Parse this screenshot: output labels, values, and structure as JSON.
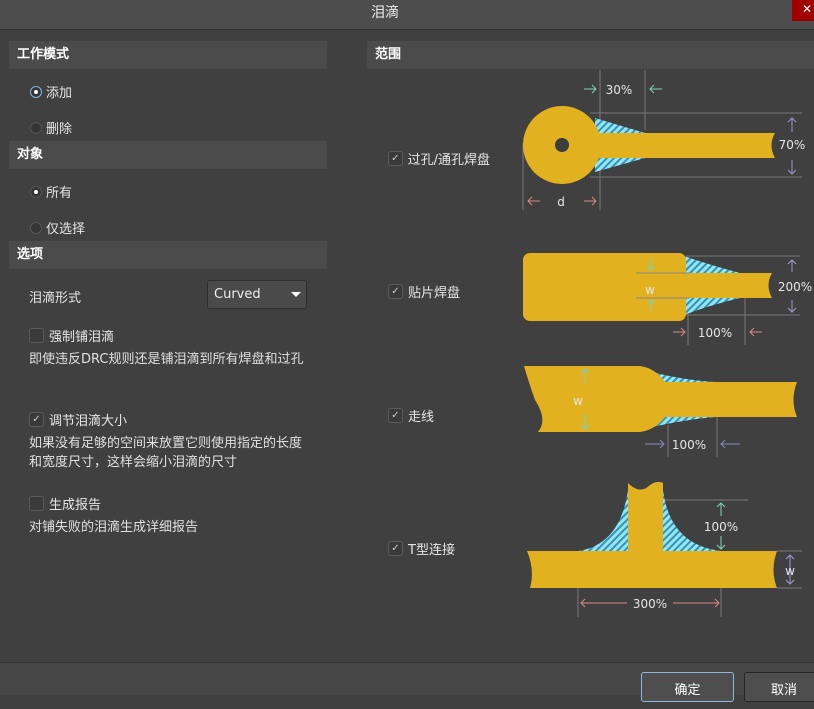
{
  "window": {
    "title": "泪滴",
    "close_icon": "close-icon"
  },
  "mode": {
    "header": "工作模式",
    "options": [
      {
        "label": "添加",
        "selected": true
      },
      {
        "label": "删除",
        "selected": false
      }
    ]
  },
  "target": {
    "header": "对象",
    "options": [
      {
        "label": "所有",
        "selected": true
      },
      {
        "label": "仅选择",
        "selected": false
      }
    ]
  },
  "options": {
    "header": "选项",
    "style_label": "泪滴形式",
    "style_value": "Curved",
    "force": {
      "label": "强制铺泪滴",
      "checked": false,
      "desc": "即使违反DRC规则还是铺泪滴到所有焊盘和过孔"
    },
    "adjust": {
      "label": "调节泪滴大小",
      "checked": true,
      "desc": "如果没有足够的空间来放置它则使用指定的长度和宽度尺寸，这样会缩小泪滴的尺寸"
    },
    "report": {
      "label": "生成报告",
      "checked": false,
      "desc": "对铺失败的泪滴生成详细报告"
    }
  },
  "scope": {
    "header": "范围",
    "items": [
      {
        "label": "过孔/通孔焊盘",
        "checked": true,
        "dims": {
          "length": "30%",
          "width": "70%",
          "diameter": "d"
        }
      },
      {
        "label": "贴片焊盘",
        "checked": true,
        "dims": {
          "w": "w",
          "width": "200%",
          "length": "100%"
        }
      },
      {
        "label": "走线",
        "checked": true,
        "dims": {
          "w": "w",
          "length": "100%"
        }
      },
      {
        "label": "T型连接",
        "checked": true,
        "dims": {
          "height": "100%",
          "w": "w",
          "length": "300%"
        }
      }
    ]
  },
  "colors": {
    "copper": "#e2b11f",
    "teardrop_hatch": "#8ee8f5",
    "close": "#a00000"
  },
  "footer": {
    "ok": "确定",
    "cancel": "取消"
  }
}
